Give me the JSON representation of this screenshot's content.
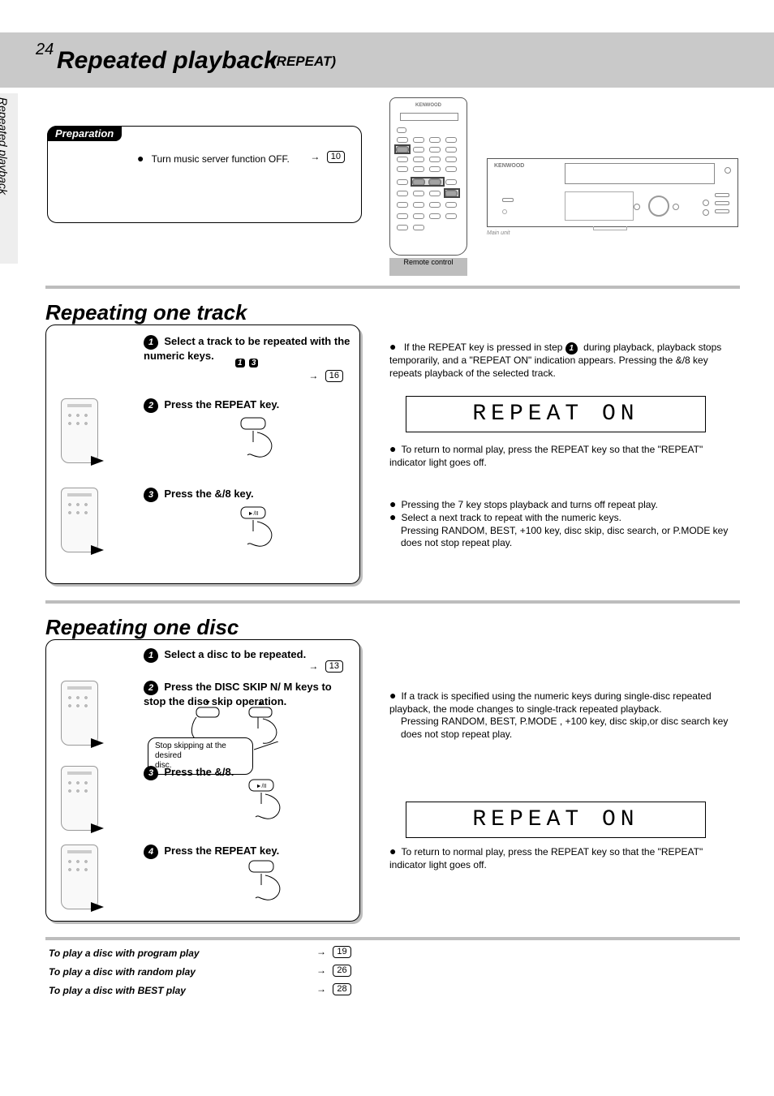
{
  "page_number": "24",
  "side_label": "Repeated playback",
  "title_main": "Repeated playback",
  "subtitle": "(REPEAT)",
  "preparation": {
    "label": "Preparation",
    "bullet_text": "Turn music server function OFF.",
    "pageref": "10"
  },
  "remote": {
    "brand": "KENWOOD",
    "label": "Remote control"
  },
  "main_unit": {
    "brand": "KENWOOD",
    "label": "Main unit"
  },
  "sectA_heading": "Repeating one track",
  "procA": {
    "step1_text": "Select a track to be repeated with the numeric keys.",
    "step1_icons": {
      "b1": "1",
      "b2": "3"
    },
    "step1_ref": "16",
    "step2_text": "Press the REPEAT key.",
    "step3_text": "Press the &/8 key."
  },
  "notesA": {
    "n1_line1": "If the REPEAT key is pressed in step",
    "n1_line2": "during playback, playback stops temporarily, and a \"REPEAT ON\" indication appears. Pressing the &/8 key repeats playback of the selected track.",
    "n2": "To return to normal play, press the REPEAT key so that the \"REPEAT\" indicator light goes off.",
    "n3": "Pressing the 7 key stops playback and turns off repeat play.",
    "n4_line1": "Select a next track to repeat with the numeric keys.",
    "n4_line2": "Pressing RANDOM, BEST, +100 key, disc skip, disc search, or P.MODE key does not stop repeat play."
  },
  "lcd1": "REPEAT ON",
  "sectB_heading": "Repeating one disc",
  "procB": {
    "step1_text": "Select a disc to be repeated.",
    "step1_ref": "13",
    "step2_text": "Press the DISC SKIP N/ M keys to stop the disc skip operation.",
    "step2_bubble_line1": "Stop skipping at the desired",
    "step2_bubble_line2": "disc.",
    "step3_text": "Press the &/8.",
    "step4_text": "Press the REPEAT key."
  },
  "notesB": {
    "n1_line1": "If a track is specified using the numeric keys during single-disc repeated playback, the mode changes to single-track repeated playback.",
    "n1_line2": "Pressing RANDOM, BEST, P.MODE , +100 key, disc skip,or disc search key does not stop repeat play.",
    "n2": "To return to normal play, press the REPEAT key so that the \"REPEAT\" indicator light goes off."
  },
  "lcd2": "REPEAT ON",
  "footer": {
    "f1_text": "To play a disc with program play",
    "f1_ref": "19",
    "f2_text": "To play a disc with random play",
    "f2_ref": "26",
    "f3_text": "To play a disc with BEST play",
    "f3_ref": "28"
  }
}
